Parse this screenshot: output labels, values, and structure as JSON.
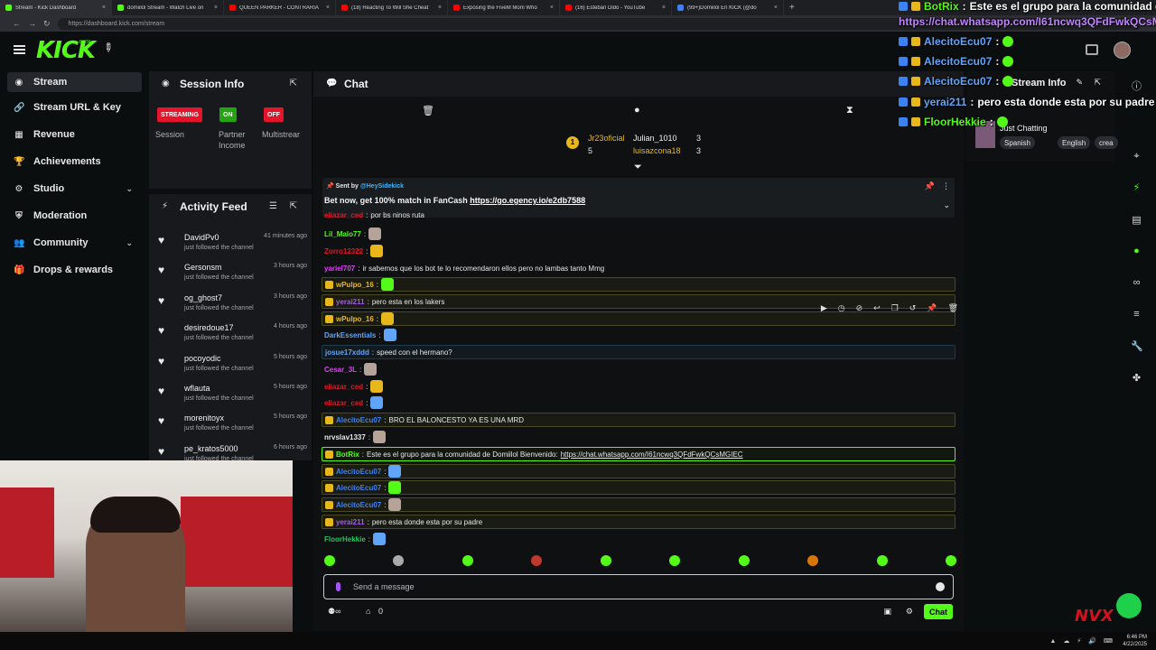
{
  "browser": {
    "tabs": [
      {
        "label": "Stream - Kick Dashboard",
        "color": "#53fc18"
      },
      {
        "label": "domiilol Stream - Watch Live on",
        "color": "#53fc18"
      },
      {
        "label": "QUEEN PARKER - CONTRARIA",
        "color": "#ff0000"
      },
      {
        "label": "(18) Reacting To Will She Cheat",
        "color": "#ff0000"
      },
      {
        "label": "Exposing the FiveM Mom Who",
        "color": "#ff0000"
      },
      {
        "label": "(16) Esteban Dido - YouTube",
        "color": "#ff0000"
      },
      {
        "label": "(99+)Domiilol En KICK (@do",
        "color": "#3b82f6"
      }
    ],
    "url": "https://dashboard.kick.com/stream"
  },
  "header": {
    "logo": "KICK",
    "beta": "BETA"
  },
  "sidebar": {
    "items": [
      {
        "label": "Stream",
        "icon": "radio-icon"
      },
      {
        "label": "Stream URL & Key",
        "icon": "link-icon"
      },
      {
        "label": "Revenue",
        "icon": "revenue-icon"
      },
      {
        "label": "Achievements",
        "icon": "trophy-icon"
      },
      {
        "label": "Studio",
        "icon": "gear-icon"
      },
      {
        "label": "Moderation",
        "icon": "shield-icon"
      },
      {
        "label": "Community",
        "icon": "users-icon"
      },
      {
        "label": "Drops & rewards",
        "icon": "gift-icon"
      }
    ]
  },
  "session": {
    "title": "Session Info",
    "badges": [
      {
        "text": "STREAMING",
        "label": "Session",
        "color": "#e5142b"
      },
      {
        "text": "ON",
        "label": "Partner Income",
        "color": "#22a511"
      },
      {
        "text": "OFF",
        "label": "Multistrear",
        "color": "#e5142b"
      }
    ]
  },
  "activity": {
    "title": "Activity Feed",
    "items": [
      {
        "name": "DavidPv0",
        "time": "41 minutes ago",
        "sub": "just followed the channel"
      },
      {
        "name": "Gersonsm",
        "time": "3 hours ago",
        "sub": "just followed the channel"
      },
      {
        "name": "og_ghost7",
        "time": "3 hours ago",
        "sub": "just followed the channel"
      },
      {
        "name": "desiredoue17",
        "time": "4 hours ago",
        "sub": "just followed the channel"
      },
      {
        "name": "pocoyodic",
        "time": "5 hours ago",
        "sub": "just followed the channel"
      },
      {
        "name": "wflauta",
        "time": "5 hours ago",
        "sub": "just followed the channel"
      },
      {
        "name": "morenitoyx",
        "time": "5 hours ago",
        "sub": "just followed the channel"
      },
      {
        "name": "pe_kratos5000",
        "time": "6 hours ago",
        "sub": "just followed the channel"
      }
    ]
  },
  "chat": {
    "title": "Chat",
    "leaders": [
      {
        "name": "Jr23oficial",
        "count": "5",
        "color": "#e8b81a"
      },
      {
        "name": "Julian_1010",
        "count": "3",
        "color": "#f1f3f4"
      },
      {
        "name": "luisazcona18",
        "count": "3",
        "color": "#e8b81a"
      }
    ],
    "pinned": {
      "by_prefix": "Sent by",
      "by_user": "@HeySidekick",
      "text": "Bet now, get 100% match in FanCash",
      "link": "https://go.egency.io/e2db7588"
    },
    "messages": [
      {
        "user": "eliazar_ced",
        "color": "#e5142b",
        "text": "por bs ninos ruta",
        "style": ""
      },
      {
        "user": "Lil_Malo77",
        "color": "#53fc18",
        "text": "",
        "style": ""
      },
      {
        "user": "Zorro12322",
        "color": "#e5142b",
        "text": "",
        "style": ""
      },
      {
        "user": "yariel707",
        "color": "#d946ef",
        "text": "ir sabemos que los bot te lo recomendaron ellos pero no lambas tanto Mmg",
        "style": ""
      },
      {
        "user": "wPulpo_16",
        "color": "#e8b81a",
        "text": "",
        "style": "hl"
      },
      {
        "user": "yerai211",
        "color": "#a855f7",
        "text": "pero esta en los lakers",
        "style": "hl"
      },
      {
        "user": "wPulpo_16",
        "color": "#e8b81a",
        "text": "",
        "style": "hl"
      },
      {
        "user": "DarkEssentials",
        "color": "#60a5fa",
        "text": "",
        "style": ""
      },
      {
        "user": "josue17xddd",
        "color": "#60a5fa",
        "text": "speed con el hermano?",
        "style": "hl2"
      },
      {
        "user": "Cesar_3L",
        "color": "#d946ef",
        "text": "",
        "style": ""
      },
      {
        "user": "eliazar_ced",
        "color": "#e5142b",
        "text": "",
        "style": ""
      },
      {
        "user": "eliazar_ced",
        "color": "#e5142b",
        "text": "",
        "style": ""
      },
      {
        "user": "AlecitoEcu07",
        "color": "#3b82f6",
        "text": "BRO EL BALONCESTO YA ES UNA MRD",
        "style": "hl"
      },
      {
        "user": "nrvslav1337",
        "color": "#e6e8ea",
        "text": "",
        "style": ""
      },
      {
        "user": "BotRix",
        "color": "#53fc18",
        "text": "Este es el grupo para la comunidad de Domiilol Bienvenido:",
        "link": "https://chat.whatsapp.com/I61ncwq3QFdFwkQCsMGIEC",
        "style": "hl3"
      },
      {
        "user": "AlecitoEcu07",
        "color": "#3b82f6",
        "text": "",
        "style": "hl"
      },
      {
        "user": "AlecitoEcu07",
        "color": "#3b82f6",
        "text": "",
        "style": "hl"
      },
      {
        "user": "AlecitoEcu07",
        "color": "#3b82f6",
        "text": "",
        "style": "hl"
      },
      {
        "user": "yerai211",
        "color": "#a855f7",
        "text": "pero esta donde esta por su padre",
        "style": "hl"
      },
      {
        "user": "FloorHekkie",
        "color": "#22c55e",
        "text": "",
        "style": ""
      }
    ],
    "placeholder": "Send a message",
    "footer_count": "0",
    "send_label": "Chat"
  },
  "stream_info": {
    "title": "Stream Info",
    "category": "Just Chatting",
    "tags": [
      "Spanish",
      "English",
      "crea"
    ]
  },
  "overlay": {
    "lines": [
      {
        "user": "BotRix",
        "text": "Este es el grupo para la comunidad de",
        "color": "#53fc18"
      },
      {
        "user": "",
        "text": "https://chat.whatsapp.com/I61ncwq3QFdFwkQCsMGIEC",
        "color": "#c084fc"
      },
      {
        "user": "AlecitoEcu07",
        "text": "",
        "color": "#60a5fa"
      },
      {
        "user": "AlecitoEcu07",
        "text": "",
        "color": "#60a5fa"
      },
      {
        "user": "AlecitoEcu07",
        "text": "",
        "color": "#60a5fa"
      },
      {
        "user": "yerai211",
        "text": "pero esta donde esta por su padre",
        "color": "#60a5fa"
      },
      {
        "user": "FloorHekkie",
        "text": "",
        "color": "#53fc18"
      }
    ],
    "watermark": "NVX"
  },
  "taskbar": {
    "time": "6:46 PM",
    "date": "4/22/2025"
  }
}
